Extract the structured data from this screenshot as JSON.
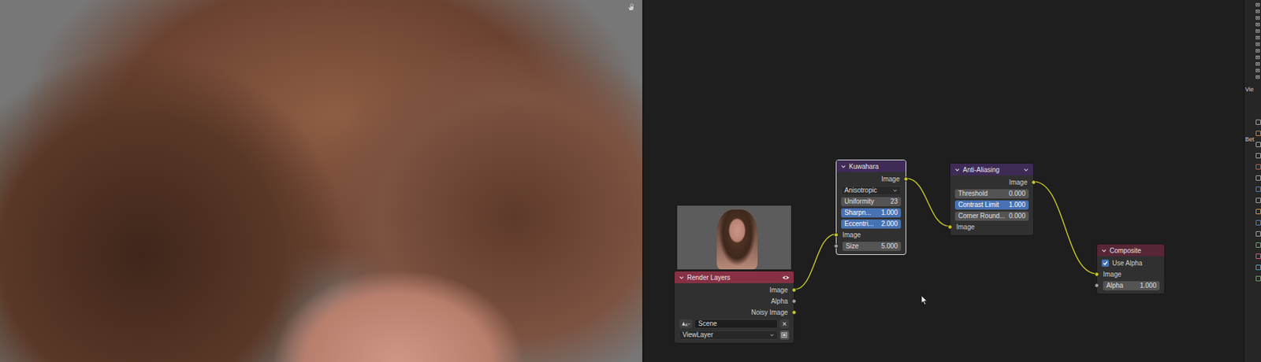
{
  "nodes": [
    {
      "title": "Render Layers",
      "color": "#873044",
      "selected": false,
      "preview": true,
      "visible": true,
      "menu": false,
      "rows": [
        {
          "kind": "output",
          "label": "Image",
          "color": "#c7c729"
        },
        {
          "kind": "output",
          "label": "Alpha",
          "color": "#a1a1a1"
        },
        {
          "kind": "output",
          "label": "Noisy Image",
          "color": "#c7c729"
        },
        {
          "kind": "scene",
          "value": "Scene"
        },
        {
          "kind": "layer_select",
          "value": "ViewLayer"
        }
      ]
    },
    {
      "title": "Kuwahara",
      "color": "#3e2b56",
      "selected": true,
      "preview": false,
      "visible": false,
      "menu": false,
      "rows": [
        {
          "kind": "output",
          "label": "Image",
          "color": "#c7c729"
        },
        {
          "kind": "select",
          "value": "Anisotropic"
        },
        {
          "kind": "field",
          "label": "Uniformity",
          "value": "23",
          "highlighted": false
        },
        {
          "kind": "field",
          "label": "Sharpn...",
          "value": "1.000",
          "highlighted": true
        },
        {
          "kind": "field",
          "label": "Eccentri...",
          "value": "2.000",
          "highlighted": true
        },
        {
          "kind": "input",
          "label": "Image",
          "color": "#c7c729"
        },
        {
          "kind": "input_field",
          "label": "Size",
          "value": "5.000",
          "color": "#a1a1a1",
          "highlighted": false
        }
      ]
    },
    {
      "title": "Anti-Aliasing",
      "color": "#3e2b56",
      "selected": false,
      "preview": false,
      "visible": false,
      "menu": true,
      "rows": [
        {
          "kind": "output",
          "label": "Image",
          "color": "#c7c729"
        },
        {
          "kind": "field",
          "label": "Threshold",
          "value": "0.000",
          "highlighted": false
        },
        {
          "kind": "field",
          "label": "Contrast Limit",
          "value": "1.000",
          "highlighted": true
        },
        {
          "kind": "field",
          "label": "Corner Round...",
          "value": "0.000",
          "highlighted": false
        },
        {
          "kind": "input",
          "label": "Image",
          "color": "#c7c729"
        }
      ]
    },
    {
      "title": "Composite",
      "color": "#582636",
      "selected": false,
      "preview": false,
      "visible": false,
      "menu": false,
      "rows": [
        {
          "kind": "checkbox",
          "label": "Use Alpha",
          "checked": true
        },
        {
          "kind": "input",
          "label": "Image",
          "color": "#c7c729"
        },
        {
          "kind": "input_field",
          "label": "Alpha",
          "value": "1.000",
          "color": "#a1a1a1",
          "highlighted": false
        }
      ]
    }
  ],
  "links": [
    {
      "from_node": "Render Layers",
      "from_socket": "Image",
      "to_node": "Kuwahara",
      "to_socket": "Image"
    },
    {
      "from_node": "Kuwahara",
      "from_socket": "Image",
      "to_node": "Anti-Aliasing",
      "to_socket": "Image"
    },
    {
      "from_node": "Anti-Aliasing",
      "from_socket": "Image",
      "to_node": "Composite",
      "to_socket": "Image"
    }
  ],
  "side_panel": {
    "texts": [
      "Vie",
      "Bet"
    ]
  }
}
